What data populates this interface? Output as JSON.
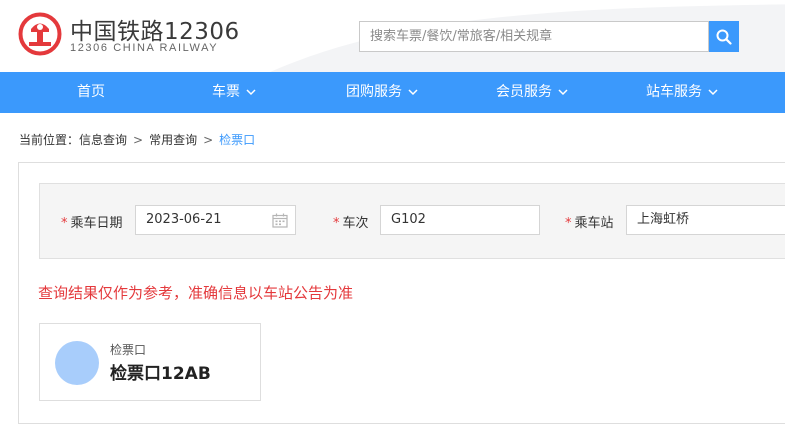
{
  "header": {
    "brand_cn": "中国铁路12306",
    "brand_en": "12306 CHINA RAILWAY",
    "logo_icon": "railway-logo-icon",
    "search": {
      "placeholder": "搜索车票/餐饮/常旅客/相关规章",
      "value": "",
      "button_icon": "search-icon"
    }
  },
  "nav": {
    "items": [
      {
        "label": "首页",
        "has_dropdown": false
      },
      {
        "label": "车票",
        "has_dropdown": true
      },
      {
        "label": "团购服务",
        "has_dropdown": true
      },
      {
        "label": "会员服务",
        "has_dropdown": true
      },
      {
        "label": "站车服务",
        "has_dropdown": true
      }
    ]
  },
  "breadcrumb": {
    "prefix": "当前位置：",
    "items": [
      "信息查询",
      "常用查询",
      "检票口"
    ],
    "separator": ">"
  },
  "filter": {
    "required_mark": "*",
    "date_label": "乘车日期",
    "date_value": "2023-06-21",
    "train_label": "车次",
    "train_value": "G102",
    "station_label": "乘车站",
    "station_value": "上海虹桥"
  },
  "notice": "查询结果仅作为参考，准确信息以车站公告为准",
  "result": {
    "label": "检票口",
    "value": "检票口12AB"
  },
  "colors": {
    "primary": "#3b99fc",
    "danger": "#e4393c",
    "logo": "#e4393c",
    "avatar": "#a8cdfb"
  }
}
